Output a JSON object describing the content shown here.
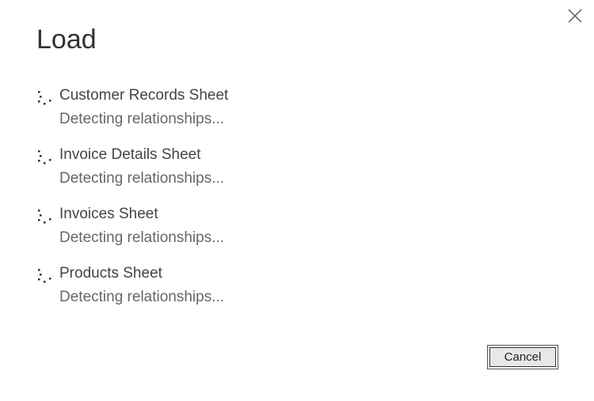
{
  "dialog": {
    "title": "Load",
    "close_icon": "close-icon"
  },
  "items": [
    {
      "name": "Customer Records Sheet",
      "status": "Detecting relationships...",
      "icon": "loading-spinner-icon"
    },
    {
      "name": "Invoice Details Sheet",
      "status": "Detecting relationships...",
      "icon": "loading-spinner-icon"
    },
    {
      "name": "Invoices Sheet",
      "status": "Detecting relationships...",
      "icon": "loading-spinner-icon"
    },
    {
      "name": "Products Sheet",
      "status": "Detecting relationships...",
      "icon": "loading-spinner-icon"
    }
  ],
  "footer": {
    "cancel_label": "Cancel"
  }
}
